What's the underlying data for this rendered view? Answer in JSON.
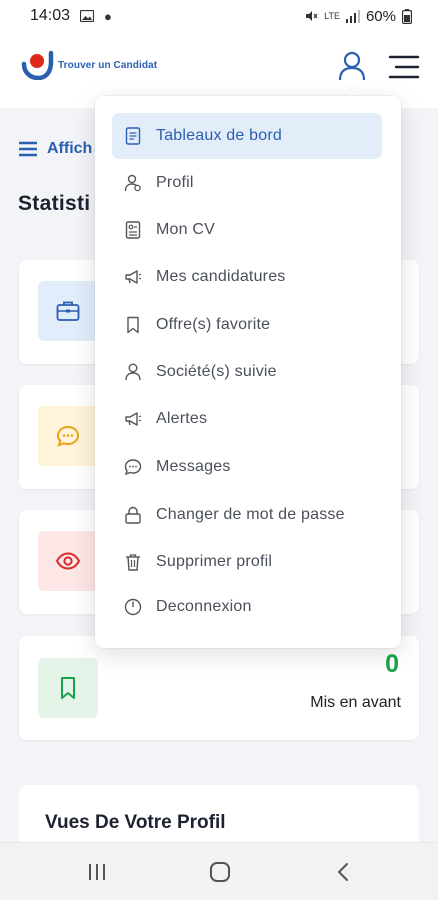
{
  "status_bar": {
    "time": "14:03",
    "battery": "60%",
    "network": "LTE"
  },
  "header": {
    "logo_text": "Trouver un Candidat",
    "brand_color": "#2a5fb0",
    "accent_color": "#e1261c"
  },
  "page": {
    "afficher_label": "Affich",
    "stats_title": "Statisti",
    "cards": [
      {
        "icon": "briefcase-icon",
        "value": "",
        "caption": ""
      },
      {
        "icon": "chat-icon",
        "value": "",
        "caption": ""
      },
      {
        "icon": "eye-icon",
        "value": "",
        "caption": ""
      },
      {
        "icon": "bookmark-icon",
        "value": "0",
        "caption": "Mis en avant"
      }
    ],
    "views_title": "Vues De Votre Profil"
  },
  "dropdown": {
    "items": [
      {
        "label": "Tableaux de bord",
        "icon": "document-icon",
        "active": true
      },
      {
        "label": "Profil",
        "icon": "profile-icon"
      },
      {
        "label": "Mon CV",
        "icon": "cv-icon"
      },
      {
        "label": "Mes candidatures",
        "icon": "megaphone-icon"
      },
      {
        "label": "Offre(s) favorite",
        "icon": "bookmark-icon"
      },
      {
        "label": "Société(s) suivie",
        "icon": "person-icon"
      },
      {
        "label": "Alertes",
        "icon": "megaphone-icon"
      },
      {
        "label": "Messages",
        "icon": "chat-icon"
      },
      {
        "label": "Changer de mot de passe",
        "icon": "lock-icon"
      },
      {
        "label": "Supprimer profil",
        "icon": "trash-icon"
      },
      {
        "label": "Deconnexion",
        "icon": "power-icon"
      }
    ]
  }
}
